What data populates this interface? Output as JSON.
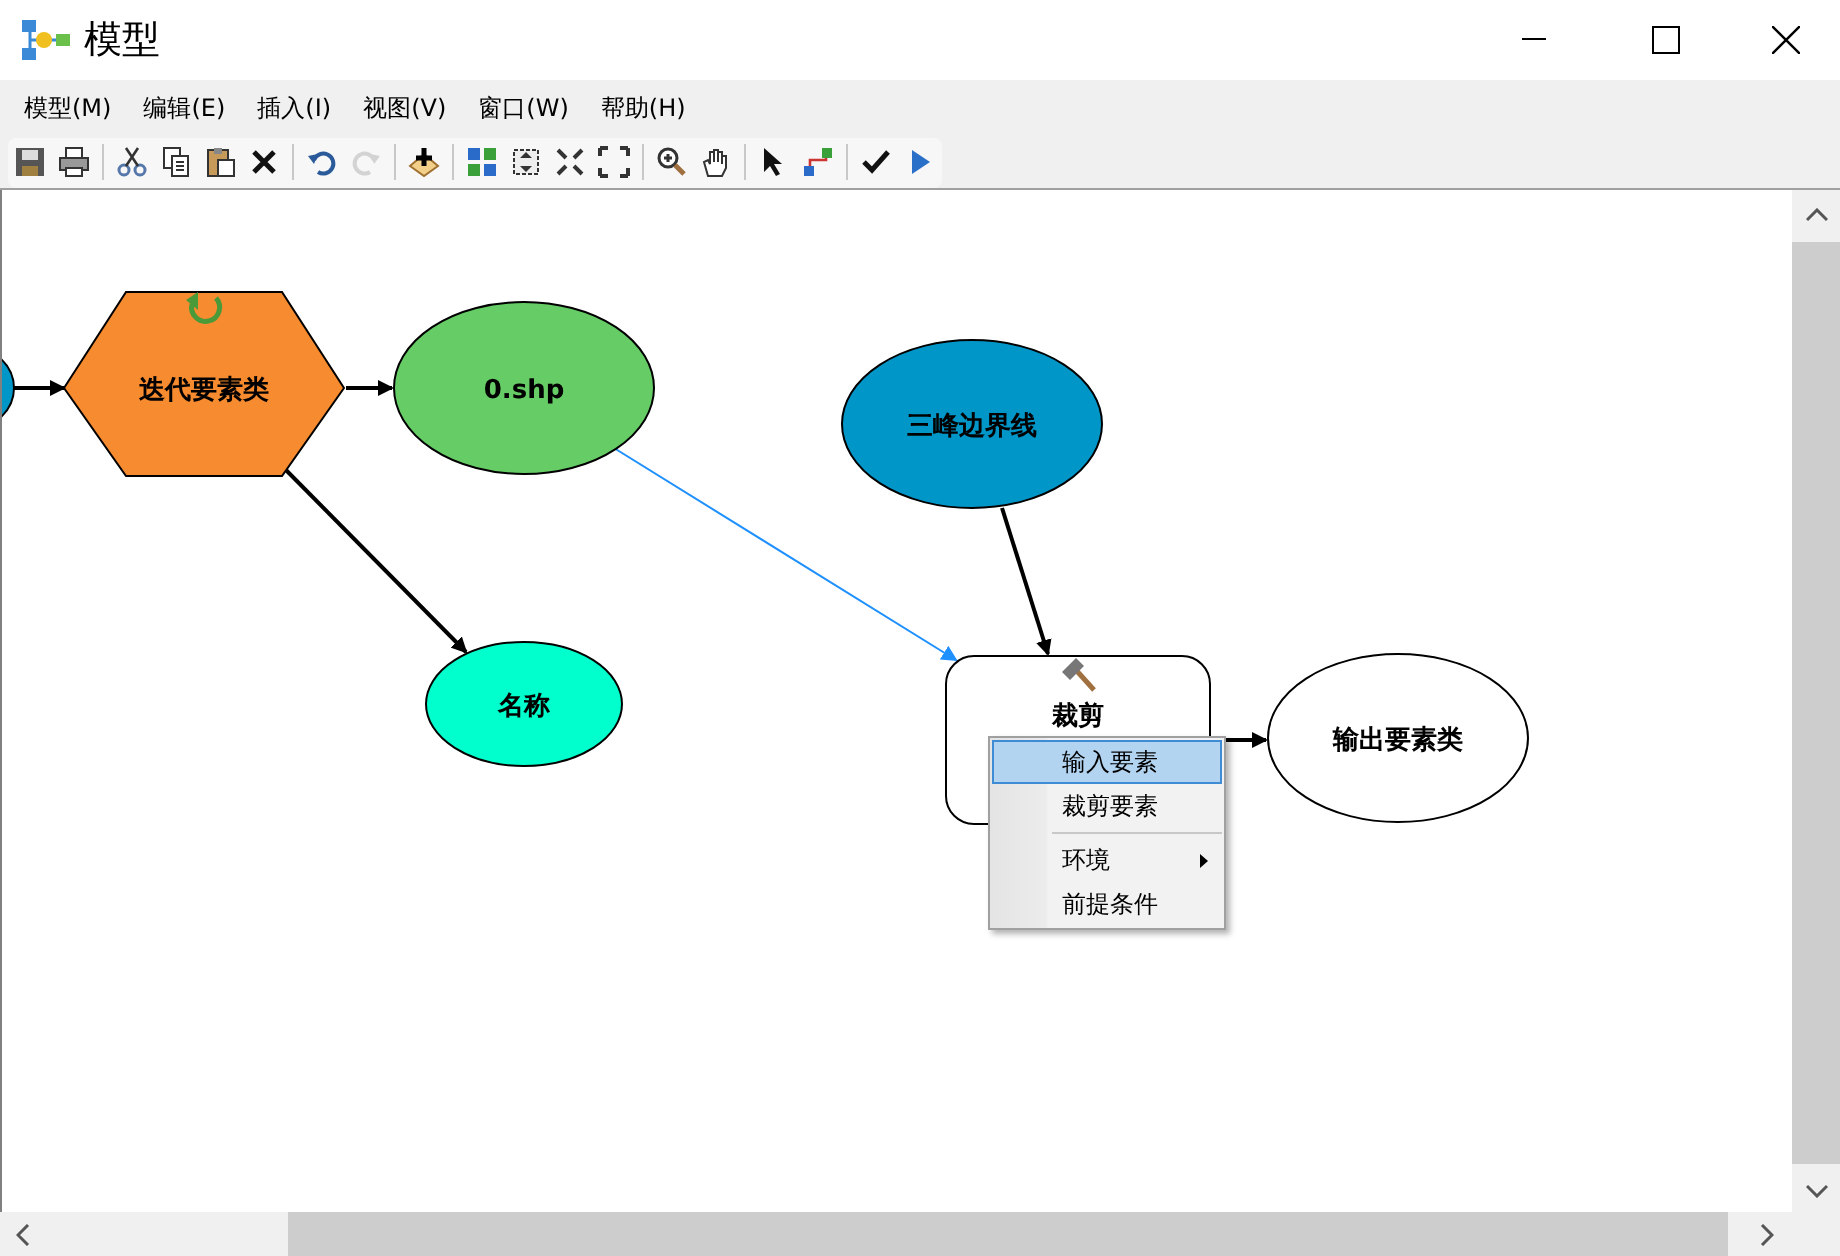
{
  "window": {
    "title": "模型"
  },
  "menu_bar": [
    "模型(M)",
    "编辑(E)",
    "插入(I)",
    "视图(V)",
    "窗口(W)",
    "帮助(H)"
  ],
  "toolbar": [
    {
      "kind": "save",
      "disabled": false
    },
    {
      "kind": "print",
      "disabled": false
    },
    {
      "kind": "sep"
    },
    {
      "kind": "cut",
      "disabled": false
    },
    {
      "kind": "copy",
      "disabled": false
    },
    {
      "kind": "paste",
      "disabled": false
    },
    {
      "kind": "delete",
      "disabled": false
    },
    {
      "kind": "sep"
    },
    {
      "kind": "undo",
      "disabled": false
    },
    {
      "kind": "redo",
      "disabled": true
    },
    {
      "kind": "sep"
    },
    {
      "kind": "add",
      "disabled": false
    },
    {
      "kind": "sep"
    },
    {
      "kind": "layout",
      "disabled": false
    },
    {
      "kind": "fit",
      "disabled": false
    },
    {
      "kind": "shrink",
      "disabled": false
    },
    {
      "kind": "expand",
      "disabled": false
    },
    {
      "kind": "sep"
    },
    {
      "kind": "zoom",
      "disabled": false
    },
    {
      "kind": "pan",
      "disabled": false
    },
    {
      "kind": "sep"
    },
    {
      "kind": "select",
      "disabled": false
    },
    {
      "kind": "connect",
      "disabled": false
    },
    {
      "kind": "sep"
    },
    {
      "kind": "validate",
      "disabled": false
    },
    {
      "kind": "run",
      "disabled": false
    }
  ],
  "nodes": [
    {
      "kind": "hexagon",
      "label": "迭代要素类",
      "color": "#f68b2f"
    },
    {
      "kind": "ellipse",
      "label": "0.shp",
      "color": "#66cc66"
    },
    {
      "kind": "ellipse",
      "label": "三峰边界线",
      "color": "#0096c8"
    },
    {
      "kind": "ellipse",
      "label": "名称",
      "color": "#00ffcc"
    },
    {
      "kind": "tool",
      "label": "裁剪",
      "color": "#ffffff"
    },
    {
      "kind": "ellipse",
      "label": "输出要素类",
      "color": "#ffffff"
    }
  ],
  "context_menu": [
    {
      "kind": "item",
      "label": "输入要素",
      "selected": true
    },
    {
      "kind": "item",
      "label": "裁剪要素",
      "selected": false
    },
    {
      "kind": "separator"
    },
    {
      "kind": "submenu",
      "label": "环境",
      "selected": false
    },
    {
      "kind": "item",
      "label": "前提条件",
      "selected": false
    }
  ]
}
